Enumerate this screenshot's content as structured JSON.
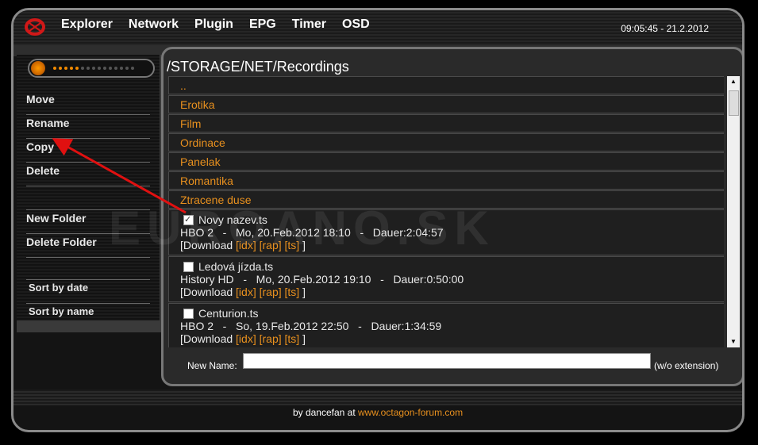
{
  "header": {
    "menu": [
      "Explorer",
      "Network",
      "Plugin",
      "EPG",
      "Timer",
      "OSD"
    ],
    "clock": "09:05:45 - 21.2.2012"
  },
  "volume": {
    "level": 5,
    "max": 15
  },
  "sidebar": {
    "items": [
      "Move",
      "Rename",
      "Copy",
      "Delete",
      "New Folder",
      "Delete Folder",
      "Sort by date",
      "Sort by name"
    ]
  },
  "main": {
    "path": "/STORAGE/NET/Recordings",
    "folders": [
      "..",
      "Erotika",
      "Film",
      "Ordinace",
      "Panelak",
      "Romantika",
      "Ztracene duse"
    ],
    "files": [
      {
        "name": "Novy nazev.ts",
        "checked": true,
        "info": "HBO 2   -   Mo, 20.Feb.2012 18:10   -   Dauer:2:04:57"
      },
      {
        "name": "Ledová jízda.ts",
        "checked": false,
        "info": "History HD   -   Mo, 20.Feb.2012 19:10   -   Dauer:0:50:00"
      },
      {
        "name": "Centurion.ts",
        "checked": false,
        "info": "HBO 2   -   So, 19.Feb.2012 22:50   -   Dauer:1:34:59"
      }
    ],
    "download_label": "[Download",
    "links": [
      "[idx]",
      "[rap]",
      "[ts]"
    ],
    "close_bracket": "]",
    "new_name_label": "New Name:",
    "new_name_value": "",
    "wo_extension": "(w/o extension)"
  },
  "watermark": "EUROANO.SK",
  "footer": {
    "text": "by dancefan at",
    "link": "www.octagon-forum.com"
  }
}
